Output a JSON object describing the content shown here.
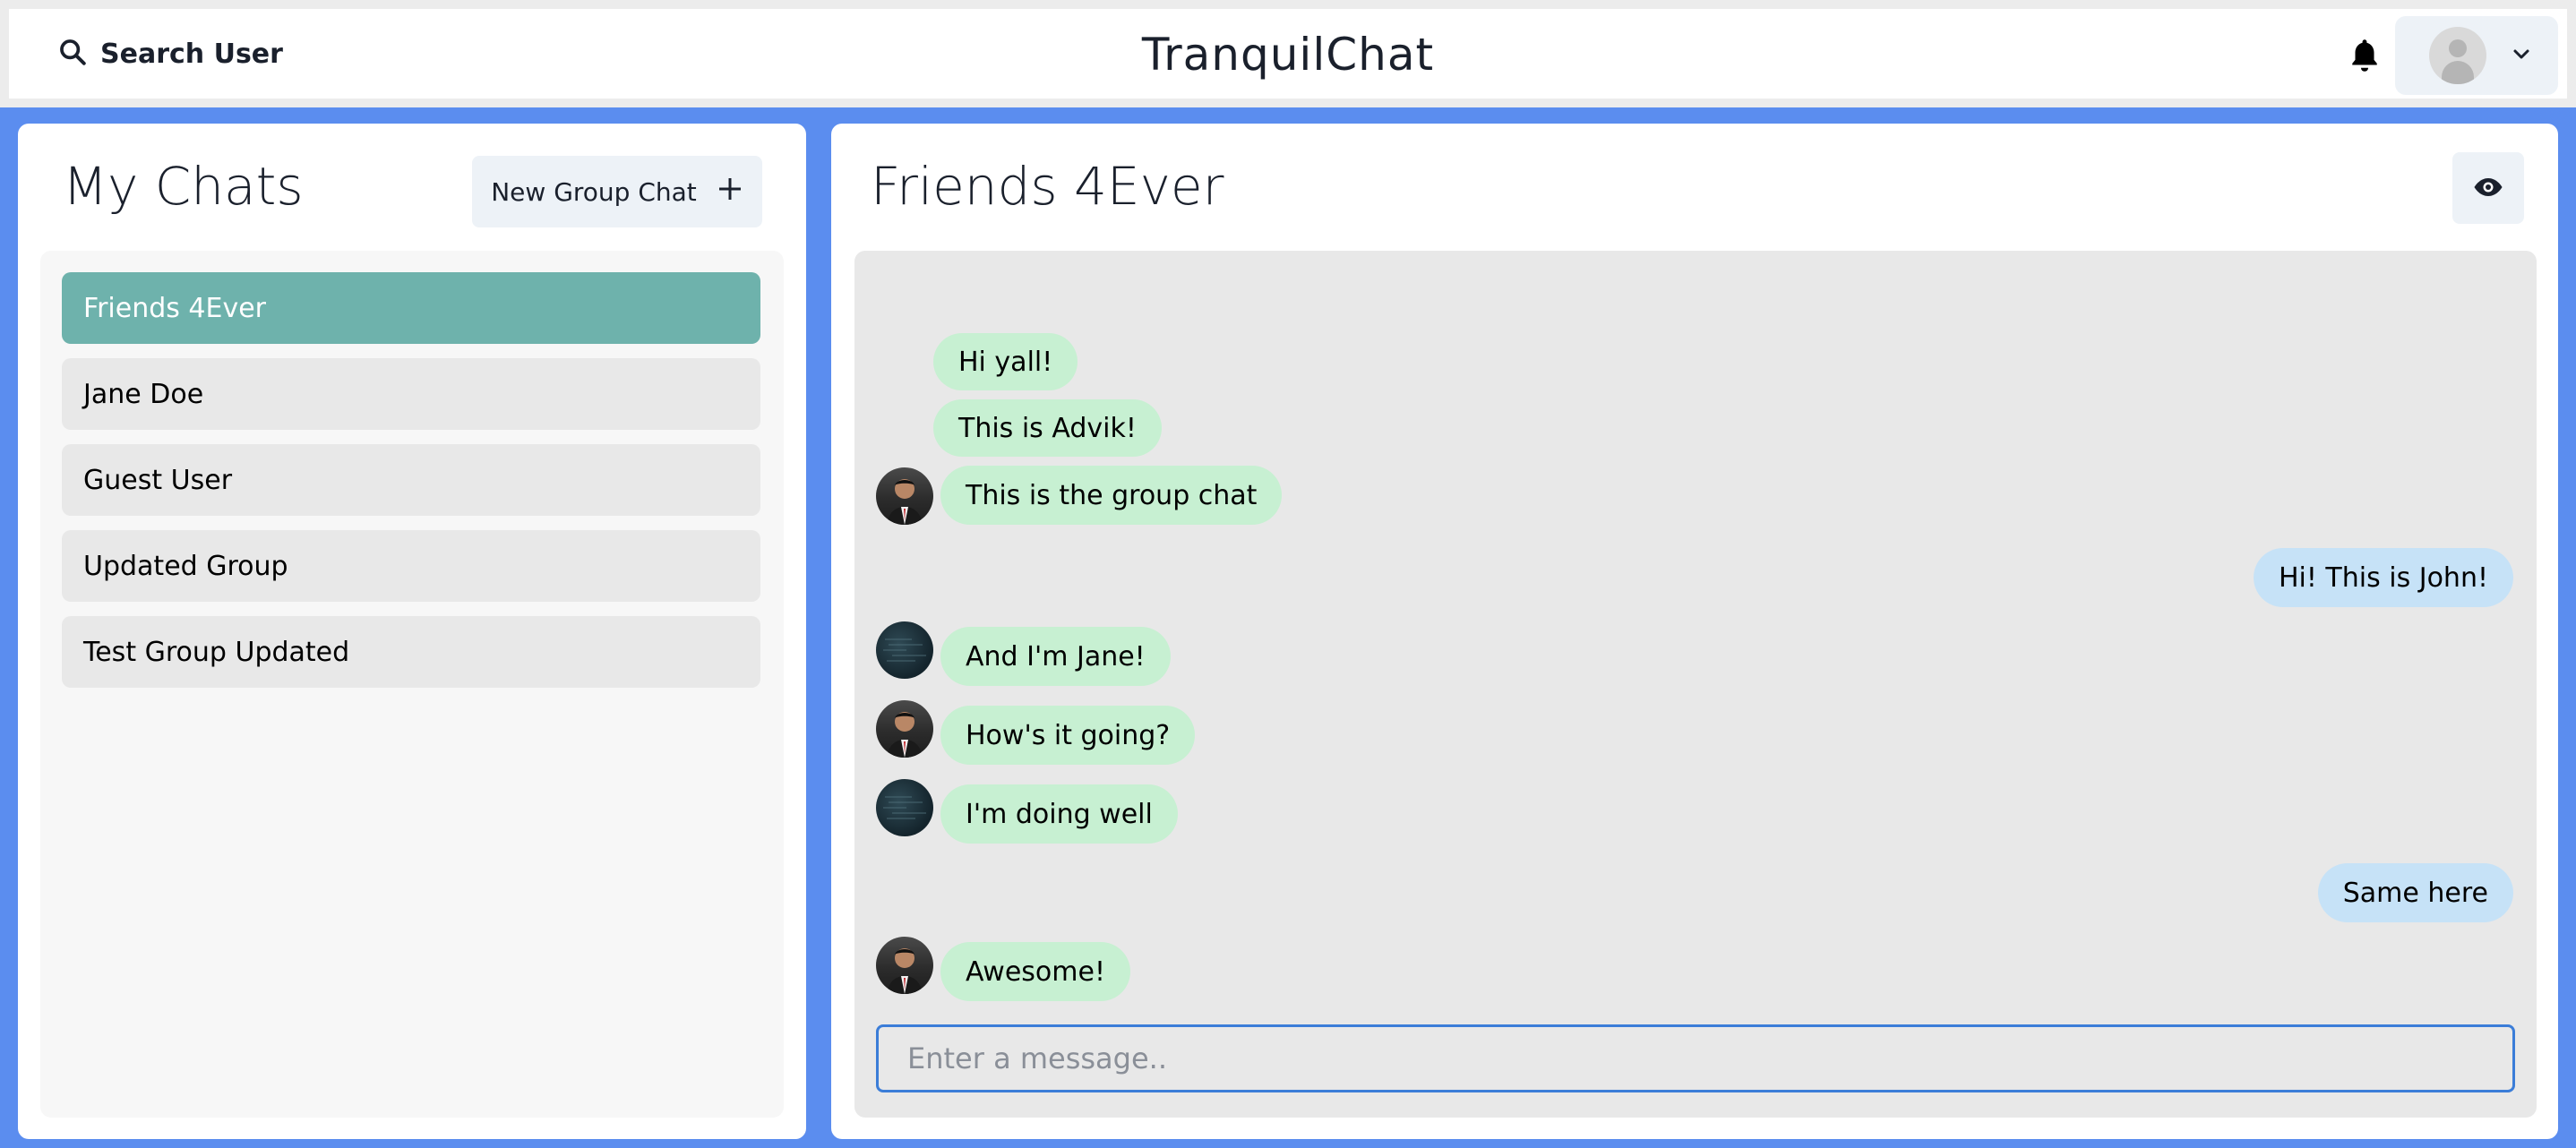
{
  "header": {
    "search_label": "Search User",
    "app_title": "TranquilChat",
    "icons": {
      "search": "search-icon",
      "bell": "bell-icon",
      "profile": "avatar",
      "chevron": "chevron-down-icon"
    }
  },
  "sidebar": {
    "title": "My Chats",
    "new_group_label": "New Group Chat",
    "chats": [
      {
        "label": "Friends 4Ever",
        "active": true
      },
      {
        "label": "Jane Doe",
        "active": false
      },
      {
        "label": "Guest User",
        "active": false
      },
      {
        "label": "Updated Group",
        "active": false
      },
      {
        "label": "Test Group Updated",
        "active": false
      }
    ]
  },
  "chat": {
    "title": "Friends 4Ever",
    "messages": [
      {
        "text": "Hi yall!",
        "direction": "in",
        "sender": "advik",
        "show_avatar": false
      },
      {
        "text": "This is Advik!",
        "direction": "in",
        "sender": "advik",
        "show_avatar": false
      },
      {
        "text": "This is the group chat",
        "direction": "in",
        "sender": "advik",
        "show_avatar": true
      },
      {
        "text": "Hi! This is John!",
        "direction": "out",
        "sender": "john",
        "show_avatar": false
      },
      {
        "text": "And I'm Jane!",
        "direction": "in",
        "sender": "jane",
        "show_avatar": true
      },
      {
        "text": "How's it going?",
        "direction": "in",
        "sender": "advik",
        "show_avatar": true
      },
      {
        "text": "I'm doing well",
        "direction": "in",
        "sender": "jane",
        "show_avatar": true
      },
      {
        "text": "Same here",
        "direction": "out",
        "sender": "john",
        "show_avatar": false
      },
      {
        "text": "Awesome!",
        "direction": "in",
        "sender": "advik",
        "show_avatar": true
      }
    ],
    "input_placeholder": "Enter a message.."
  },
  "colors": {
    "page_bg": "#5b8def",
    "active_chat": "#6eb2ac",
    "incoming_bubble": "#c7f0d2",
    "outgoing_bubble": "#c6e2f7",
    "input_border": "#3b7dd8"
  }
}
